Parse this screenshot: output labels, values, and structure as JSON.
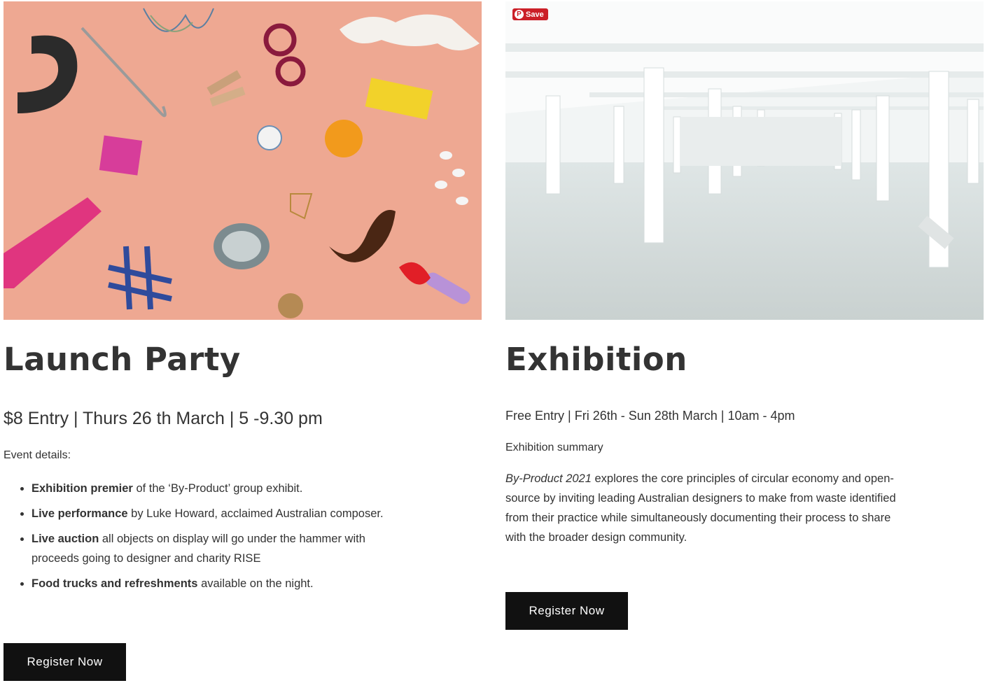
{
  "launch": {
    "image_alt": "Assorted waste material objects on a pink background",
    "title": "Launch Party",
    "meta": "$8 Entry | Thurs 26 th March | 5 -9.30 pm",
    "details_label": "Event details:",
    "bullets": [
      {
        "bold": "Exhibition premier",
        "text": " of the ‘By-Product’ group exhibit."
      },
      {
        "bold": "Live performance",
        "text": " by Luke Howard, acclaimed Australian composer."
      },
      {
        "bold": "Live auction",
        "text": " all objects on display will go under the hammer with proceeds going to designer and charity RISE"
      },
      {
        "bold": "Food trucks and refreshments",
        "text": " available on the night."
      }
    ],
    "button_label": "Register Now"
  },
  "exhibition": {
    "pin_save_label": "Save",
    "title": "Exhibition",
    "meta": "Free Entry | Fri 26th - Sun 28th March | 10am - 4pm",
    "summary_label": "Exhibition summary",
    "summary_italic": "By-Product 2021",
    "summary_text": " explores the core principles of circular economy and open-source by inviting leading Australian designers to make from waste identified from their practice while simultaneously documenting their process to share with the broader design community.",
    "button_label": "Register Now"
  },
  "colors": {
    "button_bg": "#111111",
    "pinterest_red": "#cb1f27",
    "photo_pink": "#eea892",
    "text": "#333333"
  }
}
